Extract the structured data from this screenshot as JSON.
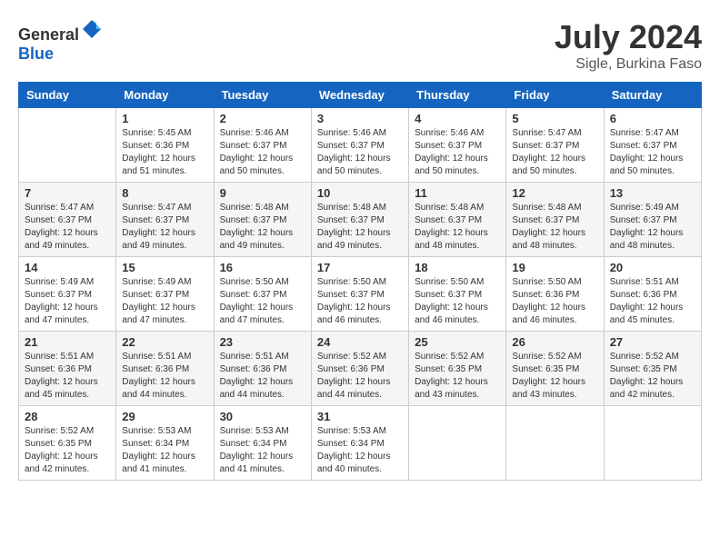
{
  "header": {
    "logo_general": "General",
    "logo_blue": "Blue",
    "month_title": "July 2024",
    "location": "Sigle, Burkina Faso"
  },
  "weekdays": [
    "Sunday",
    "Monday",
    "Tuesday",
    "Wednesday",
    "Thursday",
    "Friday",
    "Saturday"
  ],
  "weeks": [
    [
      {
        "day": "",
        "sunrise": "",
        "sunset": "",
        "daylight": ""
      },
      {
        "day": "1",
        "sunrise": "Sunrise: 5:45 AM",
        "sunset": "Sunset: 6:36 PM",
        "daylight": "Daylight: 12 hours and 51 minutes."
      },
      {
        "day": "2",
        "sunrise": "Sunrise: 5:46 AM",
        "sunset": "Sunset: 6:37 PM",
        "daylight": "Daylight: 12 hours and 50 minutes."
      },
      {
        "day": "3",
        "sunrise": "Sunrise: 5:46 AM",
        "sunset": "Sunset: 6:37 PM",
        "daylight": "Daylight: 12 hours and 50 minutes."
      },
      {
        "day": "4",
        "sunrise": "Sunrise: 5:46 AM",
        "sunset": "Sunset: 6:37 PM",
        "daylight": "Daylight: 12 hours and 50 minutes."
      },
      {
        "day": "5",
        "sunrise": "Sunrise: 5:47 AM",
        "sunset": "Sunset: 6:37 PM",
        "daylight": "Daylight: 12 hours and 50 minutes."
      },
      {
        "day": "6",
        "sunrise": "Sunrise: 5:47 AM",
        "sunset": "Sunset: 6:37 PM",
        "daylight": "Daylight: 12 hours and 50 minutes."
      }
    ],
    [
      {
        "day": "7",
        "sunrise": "Sunrise: 5:47 AM",
        "sunset": "Sunset: 6:37 PM",
        "daylight": "Daylight: 12 hours and 49 minutes."
      },
      {
        "day": "8",
        "sunrise": "Sunrise: 5:47 AM",
        "sunset": "Sunset: 6:37 PM",
        "daylight": "Daylight: 12 hours and 49 minutes."
      },
      {
        "day": "9",
        "sunrise": "Sunrise: 5:48 AM",
        "sunset": "Sunset: 6:37 PM",
        "daylight": "Daylight: 12 hours and 49 minutes."
      },
      {
        "day": "10",
        "sunrise": "Sunrise: 5:48 AM",
        "sunset": "Sunset: 6:37 PM",
        "daylight": "Daylight: 12 hours and 49 minutes."
      },
      {
        "day": "11",
        "sunrise": "Sunrise: 5:48 AM",
        "sunset": "Sunset: 6:37 PM",
        "daylight": "Daylight: 12 hours and 48 minutes."
      },
      {
        "day": "12",
        "sunrise": "Sunrise: 5:48 AM",
        "sunset": "Sunset: 6:37 PM",
        "daylight": "Daylight: 12 hours and 48 minutes."
      },
      {
        "day": "13",
        "sunrise": "Sunrise: 5:49 AM",
        "sunset": "Sunset: 6:37 PM",
        "daylight": "Daylight: 12 hours and 48 minutes."
      }
    ],
    [
      {
        "day": "14",
        "sunrise": "Sunrise: 5:49 AM",
        "sunset": "Sunset: 6:37 PM",
        "daylight": "Daylight: 12 hours and 47 minutes."
      },
      {
        "day": "15",
        "sunrise": "Sunrise: 5:49 AM",
        "sunset": "Sunset: 6:37 PM",
        "daylight": "Daylight: 12 hours and 47 minutes."
      },
      {
        "day": "16",
        "sunrise": "Sunrise: 5:50 AM",
        "sunset": "Sunset: 6:37 PM",
        "daylight": "Daylight: 12 hours and 47 minutes."
      },
      {
        "day": "17",
        "sunrise": "Sunrise: 5:50 AM",
        "sunset": "Sunset: 6:37 PM",
        "daylight": "Daylight: 12 hours and 46 minutes."
      },
      {
        "day": "18",
        "sunrise": "Sunrise: 5:50 AM",
        "sunset": "Sunset: 6:37 PM",
        "daylight": "Daylight: 12 hours and 46 minutes."
      },
      {
        "day": "19",
        "sunrise": "Sunrise: 5:50 AM",
        "sunset": "Sunset: 6:36 PM",
        "daylight": "Daylight: 12 hours and 46 minutes."
      },
      {
        "day": "20",
        "sunrise": "Sunrise: 5:51 AM",
        "sunset": "Sunset: 6:36 PM",
        "daylight": "Daylight: 12 hours and 45 minutes."
      }
    ],
    [
      {
        "day": "21",
        "sunrise": "Sunrise: 5:51 AM",
        "sunset": "Sunset: 6:36 PM",
        "daylight": "Daylight: 12 hours and 45 minutes."
      },
      {
        "day": "22",
        "sunrise": "Sunrise: 5:51 AM",
        "sunset": "Sunset: 6:36 PM",
        "daylight": "Daylight: 12 hours and 44 minutes."
      },
      {
        "day": "23",
        "sunrise": "Sunrise: 5:51 AM",
        "sunset": "Sunset: 6:36 PM",
        "daylight": "Daylight: 12 hours and 44 minutes."
      },
      {
        "day": "24",
        "sunrise": "Sunrise: 5:52 AM",
        "sunset": "Sunset: 6:36 PM",
        "daylight": "Daylight: 12 hours and 44 minutes."
      },
      {
        "day": "25",
        "sunrise": "Sunrise: 5:52 AM",
        "sunset": "Sunset: 6:35 PM",
        "daylight": "Daylight: 12 hours and 43 minutes."
      },
      {
        "day": "26",
        "sunrise": "Sunrise: 5:52 AM",
        "sunset": "Sunset: 6:35 PM",
        "daylight": "Daylight: 12 hours and 43 minutes."
      },
      {
        "day": "27",
        "sunrise": "Sunrise: 5:52 AM",
        "sunset": "Sunset: 6:35 PM",
        "daylight": "Daylight: 12 hours and 42 minutes."
      }
    ],
    [
      {
        "day": "28",
        "sunrise": "Sunrise: 5:52 AM",
        "sunset": "Sunset: 6:35 PM",
        "daylight": "Daylight: 12 hours and 42 minutes."
      },
      {
        "day": "29",
        "sunrise": "Sunrise: 5:53 AM",
        "sunset": "Sunset: 6:34 PM",
        "daylight": "Daylight: 12 hours and 41 minutes."
      },
      {
        "day": "30",
        "sunrise": "Sunrise: 5:53 AM",
        "sunset": "Sunset: 6:34 PM",
        "daylight": "Daylight: 12 hours and 41 minutes."
      },
      {
        "day": "31",
        "sunrise": "Sunrise: 5:53 AM",
        "sunset": "Sunset: 6:34 PM",
        "daylight": "Daylight: 12 hours and 40 minutes."
      },
      {
        "day": "",
        "sunrise": "",
        "sunset": "",
        "daylight": ""
      },
      {
        "day": "",
        "sunrise": "",
        "sunset": "",
        "daylight": ""
      },
      {
        "day": "",
        "sunrise": "",
        "sunset": "",
        "daylight": ""
      }
    ]
  ]
}
